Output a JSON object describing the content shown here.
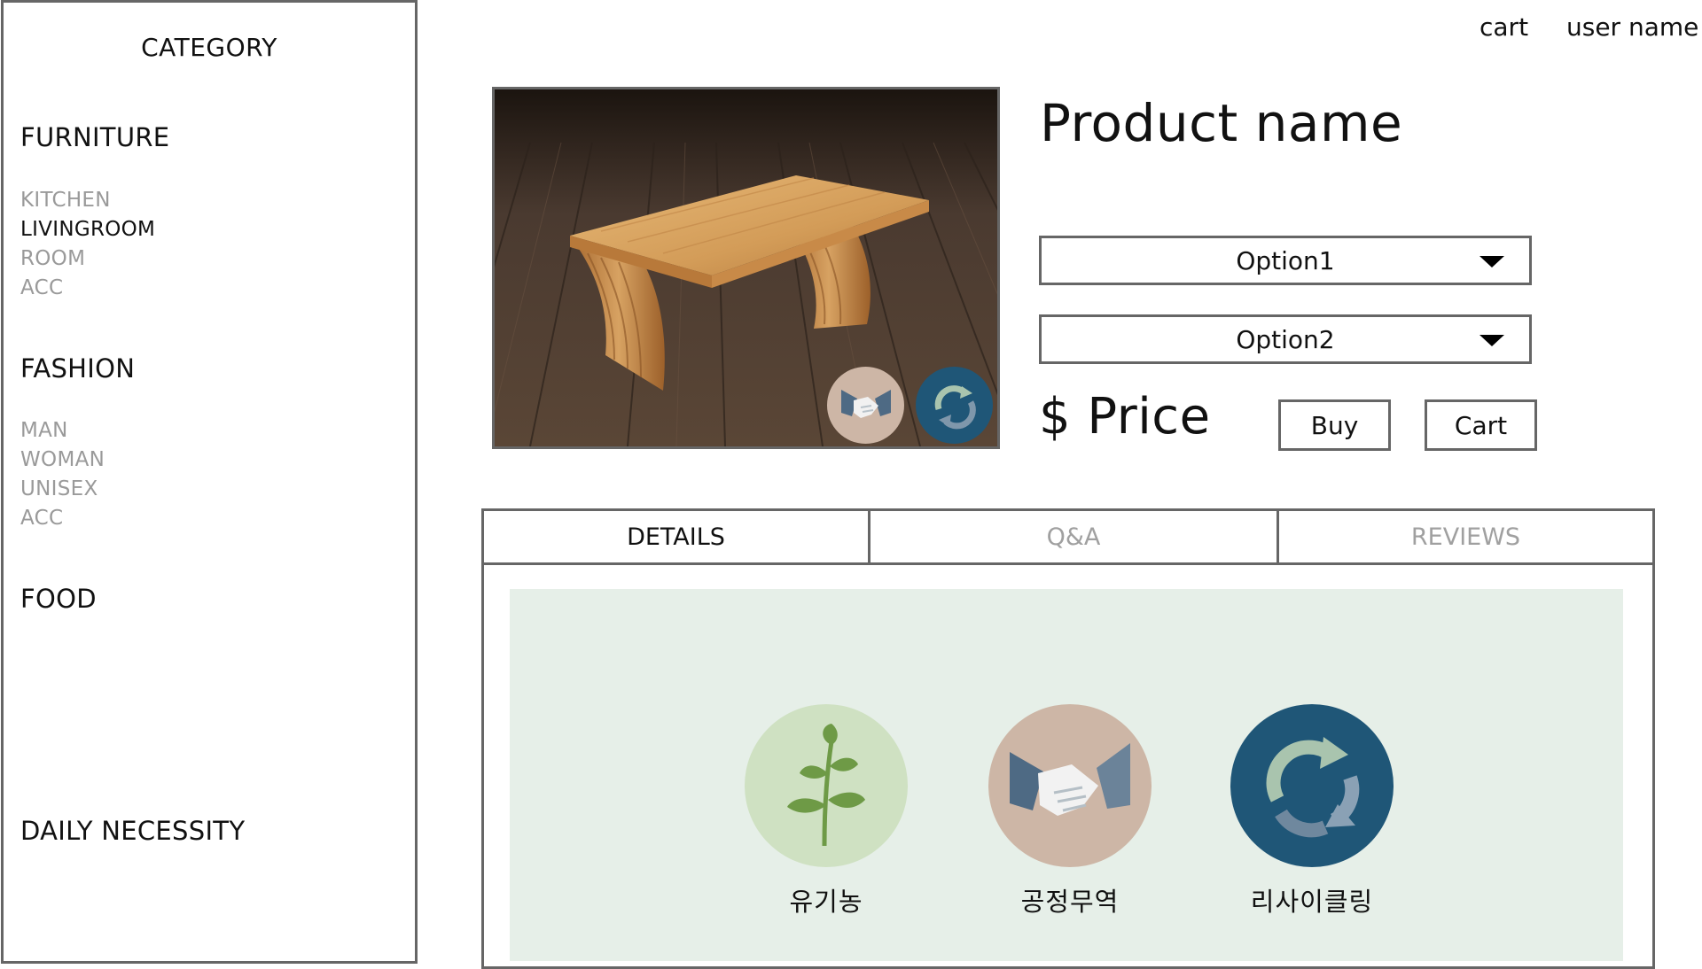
{
  "header": {
    "cart_link": "cart",
    "user_link": "user name"
  },
  "sidebar": {
    "title": "CATEGORY",
    "sections": [
      {
        "title": "FURNITURE",
        "items": [
          "KITCHEN",
          "LIVINGROOM",
          "ROOM",
          "ACC"
        ],
        "active": "LIVINGROOM"
      },
      {
        "title": "FASHION",
        "items": [
          "MAN",
          "WOMAN",
          "UNISEX",
          "ACC"
        ]
      },
      {
        "title": "FOOD",
        "items": []
      },
      {
        "title": "DAILY NECESSITY",
        "items": []
      }
    ]
  },
  "product": {
    "name": "Product name",
    "option1": "Option1",
    "option2": "Option2",
    "price": "$ Price",
    "buy_label": "Buy",
    "cart_label": "Cart",
    "image_badges": [
      "handshake-icon",
      "recycle-icon"
    ]
  },
  "tabs": [
    {
      "label": "DETAILS",
      "active": true
    },
    {
      "label": "Q&A",
      "active": false
    },
    {
      "label": "REVIEWS",
      "active": false
    }
  ],
  "details": {
    "features": [
      {
        "label": "유기농",
        "icon": "plant-icon",
        "color": "#cfe1c2"
      },
      {
        "label": "공정무역",
        "icon": "handshake-icon",
        "color": "#cdb6a6"
      },
      {
        "label": "리사이클링",
        "icon": "recycle-icon",
        "color": "#1f5677"
      }
    ],
    "background": "#e6efe8"
  }
}
